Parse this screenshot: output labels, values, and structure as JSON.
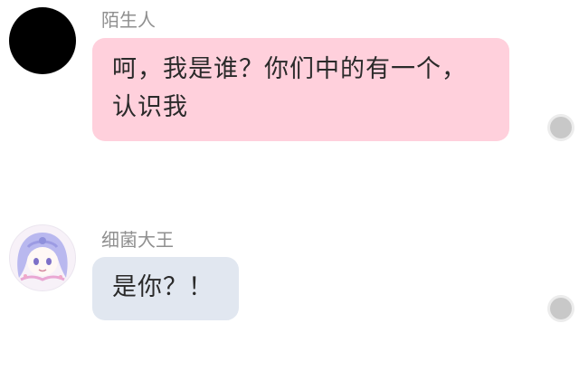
{
  "messages": [
    {
      "sender": "陌生人",
      "avatar": "black-circle-avatar",
      "lines": [
        "呵，我是谁？你们中的有一个，",
        "认识我"
      ],
      "bubble_color": "#ffd0dc"
    },
    {
      "sender": "细菌大王",
      "avatar": "anime-girl-avatar",
      "lines": [
        "是你？！"
      ],
      "bubble_color": "#e1e7f0"
    }
  ],
  "colors": {
    "sender_name": "#8f8f8f",
    "message_text": "#2a2a2a",
    "menu_dot": "#c8c8c8"
  },
  "icons": {
    "message_menu": "dot-icon"
  }
}
